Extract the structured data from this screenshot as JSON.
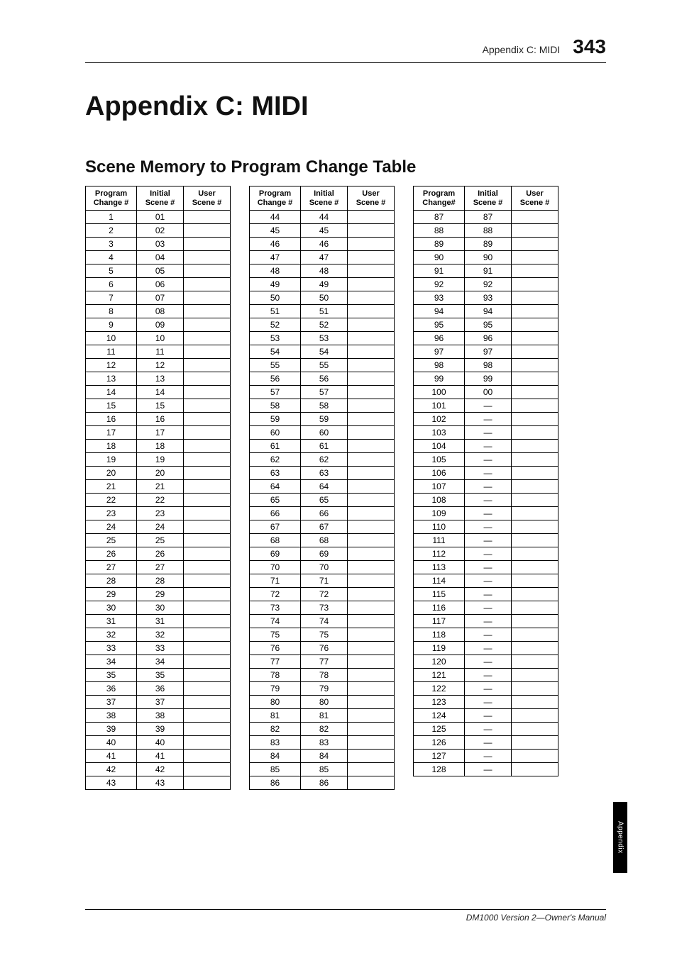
{
  "header": {
    "running": "Appendix C: MIDI",
    "page": "343"
  },
  "chapter_title": "Appendix C: MIDI",
  "section_title": "Scene Memory to Program Change Table",
  "column_headers": {
    "program_change_a": "Program\nChange #",
    "program_change_b": "Program\nChange#",
    "initial_scene": "Initial\nScene #",
    "user_scene": "User\nScene #"
  },
  "tables": [
    {
      "header_variant": "a",
      "rows": [
        {
          "pc": "1",
          "is": "01",
          "us": ""
        },
        {
          "pc": "2",
          "is": "02",
          "us": ""
        },
        {
          "pc": "3",
          "is": "03",
          "us": ""
        },
        {
          "pc": "4",
          "is": "04",
          "us": ""
        },
        {
          "pc": "5",
          "is": "05",
          "us": ""
        },
        {
          "pc": "6",
          "is": "06",
          "us": ""
        },
        {
          "pc": "7",
          "is": "07",
          "us": ""
        },
        {
          "pc": "8",
          "is": "08",
          "us": ""
        },
        {
          "pc": "9",
          "is": "09",
          "us": ""
        },
        {
          "pc": "10",
          "is": "10",
          "us": ""
        },
        {
          "pc": "11",
          "is": "11",
          "us": ""
        },
        {
          "pc": "12",
          "is": "12",
          "us": ""
        },
        {
          "pc": "13",
          "is": "13",
          "us": ""
        },
        {
          "pc": "14",
          "is": "14",
          "us": ""
        },
        {
          "pc": "15",
          "is": "15",
          "us": ""
        },
        {
          "pc": "16",
          "is": "16",
          "us": ""
        },
        {
          "pc": "17",
          "is": "17",
          "us": ""
        },
        {
          "pc": "18",
          "is": "18",
          "us": ""
        },
        {
          "pc": "19",
          "is": "19",
          "us": ""
        },
        {
          "pc": "20",
          "is": "20",
          "us": ""
        },
        {
          "pc": "21",
          "is": "21",
          "us": ""
        },
        {
          "pc": "22",
          "is": "22",
          "us": ""
        },
        {
          "pc": "23",
          "is": "23",
          "us": ""
        },
        {
          "pc": "24",
          "is": "24",
          "us": ""
        },
        {
          "pc": "25",
          "is": "25",
          "us": ""
        },
        {
          "pc": "26",
          "is": "26",
          "us": ""
        },
        {
          "pc": "27",
          "is": "27",
          "us": ""
        },
        {
          "pc": "28",
          "is": "28",
          "us": ""
        },
        {
          "pc": "29",
          "is": "29",
          "us": ""
        },
        {
          "pc": "30",
          "is": "30",
          "us": ""
        },
        {
          "pc": "31",
          "is": "31",
          "us": ""
        },
        {
          "pc": "32",
          "is": "32",
          "us": ""
        },
        {
          "pc": "33",
          "is": "33",
          "us": ""
        },
        {
          "pc": "34",
          "is": "34",
          "us": ""
        },
        {
          "pc": "35",
          "is": "35",
          "us": ""
        },
        {
          "pc": "36",
          "is": "36",
          "us": ""
        },
        {
          "pc": "37",
          "is": "37",
          "us": ""
        },
        {
          "pc": "38",
          "is": "38",
          "us": ""
        },
        {
          "pc": "39",
          "is": "39",
          "us": ""
        },
        {
          "pc": "40",
          "is": "40",
          "us": ""
        },
        {
          "pc": "41",
          "is": "41",
          "us": ""
        },
        {
          "pc": "42",
          "is": "42",
          "us": ""
        },
        {
          "pc": "43",
          "is": "43",
          "us": ""
        }
      ]
    },
    {
      "header_variant": "a",
      "rows": [
        {
          "pc": "44",
          "is": "44",
          "us": ""
        },
        {
          "pc": "45",
          "is": "45",
          "us": ""
        },
        {
          "pc": "46",
          "is": "46",
          "us": ""
        },
        {
          "pc": "47",
          "is": "47",
          "us": ""
        },
        {
          "pc": "48",
          "is": "48",
          "us": ""
        },
        {
          "pc": "49",
          "is": "49",
          "us": ""
        },
        {
          "pc": "50",
          "is": "50",
          "us": ""
        },
        {
          "pc": "51",
          "is": "51",
          "us": ""
        },
        {
          "pc": "52",
          "is": "52",
          "us": ""
        },
        {
          "pc": "53",
          "is": "53",
          "us": ""
        },
        {
          "pc": "54",
          "is": "54",
          "us": ""
        },
        {
          "pc": "55",
          "is": "55",
          "us": ""
        },
        {
          "pc": "56",
          "is": "56",
          "us": ""
        },
        {
          "pc": "57",
          "is": "57",
          "us": ""
        },
        {
          "pc": "58",
          "is": "58",
          "us": ""
        },
        {
          "pc": "59",
          "is": "59",
          "us": ""
        },
        {
          "pc": "60",
          "is": "60",
          "us": ""
        },
        {
          "pc": "61",
          "is": "61",
          "us": ""
        },
        {
          "pc": "62",
          "is": "62",
          "us": ""
        },
        {
          "pc": "63",
          "is": "63",
          "us": ""
        },
        {
          "pc": "64",
          "is": "64",
          "us": ""
        },
        {
          "pc": "65",
          "is": "65",
          "us": ""
        },
        {
          "pc": "66",
          "is": "66",
          "us": ""
        },
        {
          "pc": "67",
          "is": "67",
          "us": ""
        },
        {
          "pc": "68",
          "is": "68",
          "us": ""
        },
        {
          "pc": "69",
          "is": "69",
          "us": ""
        },
        {
          "pc": "70",
          "is": "70",
          "us": ""
        },
        {
          "pc": "71",
          "is": "71",
          "us": ""
        },
        {
          "pc": "72",
          "is": "72",
          "us": ""
        },
        {
          "pc": "73",
          "is": "73",
          "us": ""
        },
        {
          "pc": "74",
          "is": "74",
          "us": ""
        },
        {
          "pc": "75",
          "is": "75",
          "us": ""
        },
        {
          "pc": "76",
          "is": "76",
          "us": ""
        },
        {
          "pc": "77",
          "is": "77",
          "us": ""
        },
        {
          "pc": "78",
          "is": "78",
          "us": ""
        },
        {
          "pc": "79",
          "is": "79",
          "us": ""
        },
        {
          "pc": "80",
          "is": "80",
          "us": ""
        },
        {
          "pc": "81",
          "is": "81",
          "us": ""
        },
        {
          "pc": "82",
          "is": "82",
          "us": ""
        },
        {
          "pc": "83",
          "is": "83",
          "us": ""
        },
        {
          "pc": "84",
          "is": "84",
          "us": ""
        },
        {
          "pc": "85",
          "is": "85",
          "us": ""
        },
        {
          "pc": "86",
          "is": "86",
          "us": ""
        }
      ]
    },
    {
      "header_variant": "b",
      "rows": [
        {
          "pc": "87",
          "is": "87",
          "us": ""
        },
        {
          "pc": "88",
          "is": "88",
          "us": ""
        },
        {
          "pc": "89",
          "is": "89",
          "us": ""
        },
        {
          "pc": "90",
          "is": "90",
          "us": ""
        },
        {
          "pc": "91",
          "is": "91",
          "us": ""
        },
        {
          "pc": "92",
          "is": "92",
          "us": ""
        },
        {
          "pc": "93",
          "is": "93",
          "us": ""
        },
        {
          "pc": "94",
          "is": "94",
          "us": ""
        },
        {
          "pc": "95",
          "is": "95",
          "us": ""
        },
        {
          "pc": "96",
          "is": "96",
          "us": ""
        },
        {
          "pc": "97",
          "is": "97",
          "us": ""
        },
        {
          "pc": "98",
          "is": "98",
          "us": ""
        },
        {
          "pc": "99",
          "is": "99",
          "us": ""
        },
        {
          "pc": "100",
          "is": "00",
          "us": ""
        },
        {
          "pc": "101",
          "is": "—",
          "us": ""
        },
        {
          "pc": "102",
          "is": "—",
          "us": ""
        },
        {
          "pc": "103",
          "is": "—",
          "us": ""
        },
        {
          "pc": "104",
          "is": "—",
          "us": ""
        },
        {
          "pc": "105",
          "is": "—",
          "us": ""
        },
        {
          "pc": "106",
          "is": "—",
          "us": ""
        },
        {
          "pc": "107",
          "is": "—",
          "us": ""
        },
        {
          "pc": "108",
          "is": "—",
          "us": ""
        },
        {
          "pc": "109",
          "is": "—",
          "us": ""
        },
        {
          "pc": "110",
          "is": "—",
          "us": ""
        },
        {
          "pc": "111",
          "is": "—",
          "us": ""
        },
        {
          "pc": "112",
          "is": "—",
          "us": ""
        },
        {
          "pc": "113",
          "is": "—",
          "us": ""
        },
        {
          "pc": "114",
          "is": "—",
          "us": ""
        },
        {
          "pc": "115",
          "is": "—",
          "us": ""
        },
        {
          "pc": "116",
          "is": "—",
          "us": ""
        },
        {
          "pc": "117",
          "is": "—",
          "us": ""
        },
        {
          "pc": "118",
          "is": "—",
          "us": ""
        },
        {
          "pc": "119",
          "is": "—",
          "us": ""
        },
        {
          "pc": "120",
          "is": "—",
          "us": ""
        },
        {
          "pc": "121",
          "is": "—",
          "us": ""
        },
        {
          "pc": "122",
          "is": "—",
          "us": ""
        },
        {
          "pc": "123",
          "is": "—",
          "us": ""
        },
        {
          "pc": "124",
          "is": "—",
          "us": ""
        },
        {
          "pc": "125",
          "is": "—",
          "us": ""
        },
        {
          "pc": "126",
          "is": "—",
          "us": ""
        },
        {
          "pc": "127",
          "is": "—",
          "us": ""
        },
        {
          "pc": "128",
          "is": "—",
          "us": ""
        }
      ]
    }
  ],
  "side_tab": "Appendix",
  "footer": "DM1000 Version 2—Owner's Manual"
}
